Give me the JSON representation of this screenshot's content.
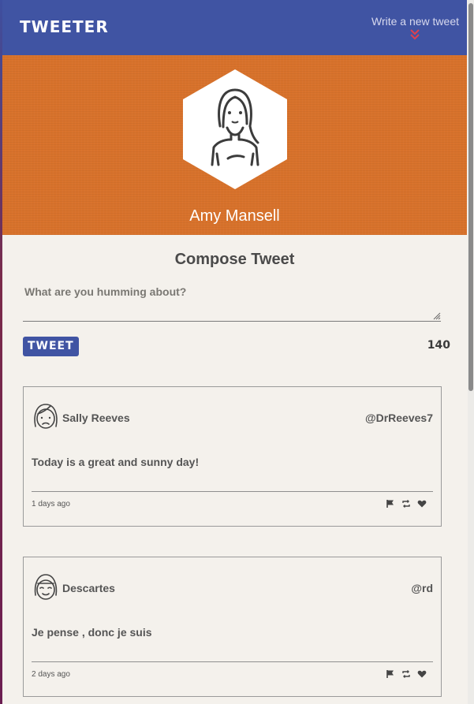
{
  "nav": {
    "brand": "TWEETER",
    "compose_toggle": "Write a new tweet"
  },
  "profile": {
    "name": "Amy Mansell"
  },
  "compose": {
    "title": "Compose Tweet",
    "placeholder": "What are you humming about?",
    "button_label": "TWEET",
    "char_count": "140"
  },
  "tweets": [
    {
      "name": "Sally Reeves",
      "handle": "@DrReeves7",
      "content": "Today is a great and sunny day!",
      "time": "1 days ago",
      "avatar_icon": "woman-face-icon"
    },
    {
      "name": "Descartes",
      "handle": "@rd",
      "content": "Je pense , donc je suis",
      "time": "2 days ago",
      "avatar_icon": "smiling-face-icon"
    }
  ],
  "colors": {
    "navbar": "#4054a3",
    "banner": "#d8722b",
    "accent": "#e0404e",
    "background": "#f4f1ec"
  }
}
